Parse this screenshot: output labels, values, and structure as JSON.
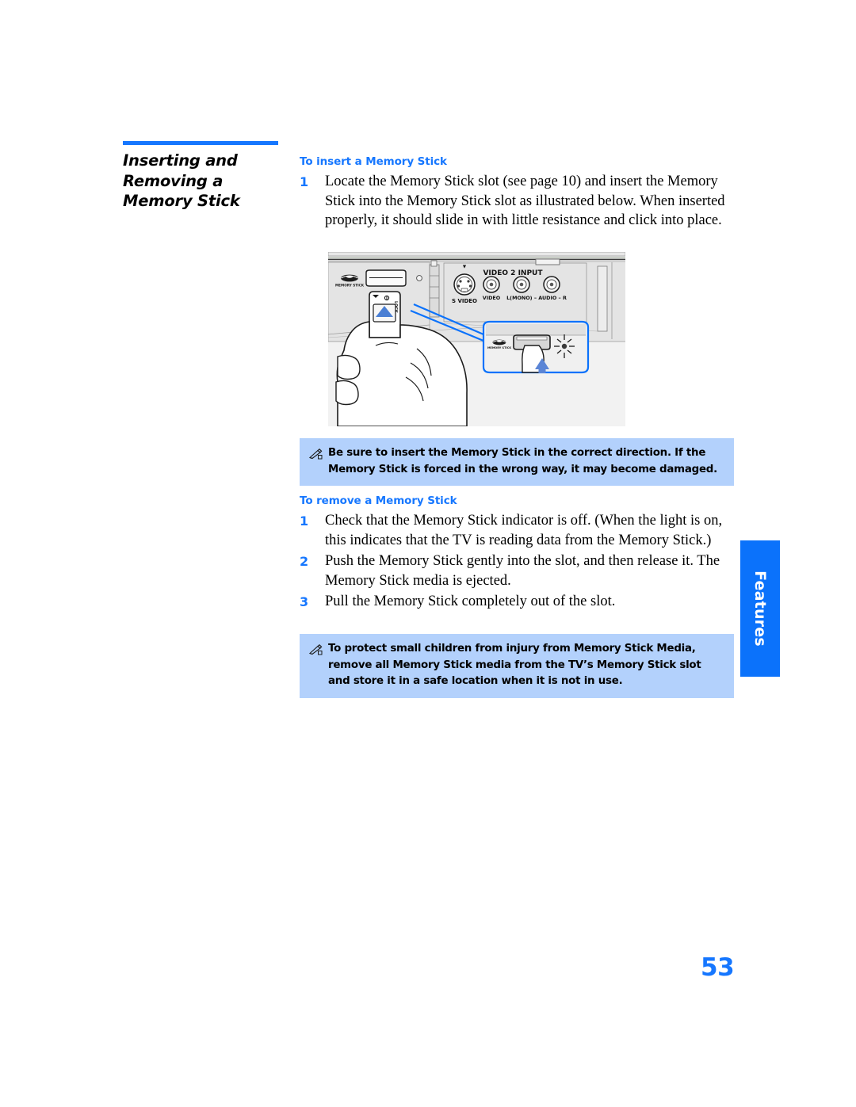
{
  "section": {
    "heading": "Inserting and Removing a Memory Stick",
    "rule_color": "#1677ff"
  },
  "insert": {
    "subheading": "To insert a Memory Stick",
    "steps": [
      {
        "number": "1",
        "text": "Locate the Memory Stick slot (see page 10) and insert the Memory Stick into the Memory Stick slot as illustrated below. When inserted properly, it should slide in with little resistance and click into place."
      }
    ]
  },
  "illustration": {
    "caption_labels": {
      "memory_stick_logo": "MEMORY STICK",
      "video_input_header": "VIDEO 2 INPUT",
      "s_video": "S VIDEO",
      "video": "VIDEO",
      "audio": "L(MONO) - AUDIO - R"
    }
  },
  "notes": [
    {
      "id": "note-insert-direction",
      "icon": "pencil-note-icon",
      "text": "Be sure to insert the Memory Stick in the correct direction. If the Memory Stick is forced in the wrong way, it may become damaged."
    },
    {
      "id": "note-child-safety",
      "icon": "pencil-note-icon",
      "text": "To protect small children from injury from Memory Stick Media, remove all Memory Stick media from the TV’s Memory Stick slot and store it in a safe location when it is not in use."
    }
  ],
  "remove": {
    "subheading": "To remove a Memory Stick",
    "steps": [
      {
        "number": "1",
        "text": "Check that the Memory Stick indicator is off. (When the light is on, this indicates that the TV is reading data from the Memory Stick.)"
      },
      {
        "number": "2",
        "text": "Push the Memory Stick gently into the slot, and then release it. The Memory Stick media is ejected."
      },
      {
        "number": "3",
        "text": "Pull the Memory Stick completely out of the slot."
      }
    ]
  },
  "side_tab": {
    "label": "Features",
    "color": "#0b72fb"
  },
  "page_number": "53",
  "colors": {
    "accent_blue": "#1677ff",
    "note_background": "#b3d1fc",
    "tab_blue": "#0b72fb",
    "arrow_blue": "#4a7fd4"
  }
}
